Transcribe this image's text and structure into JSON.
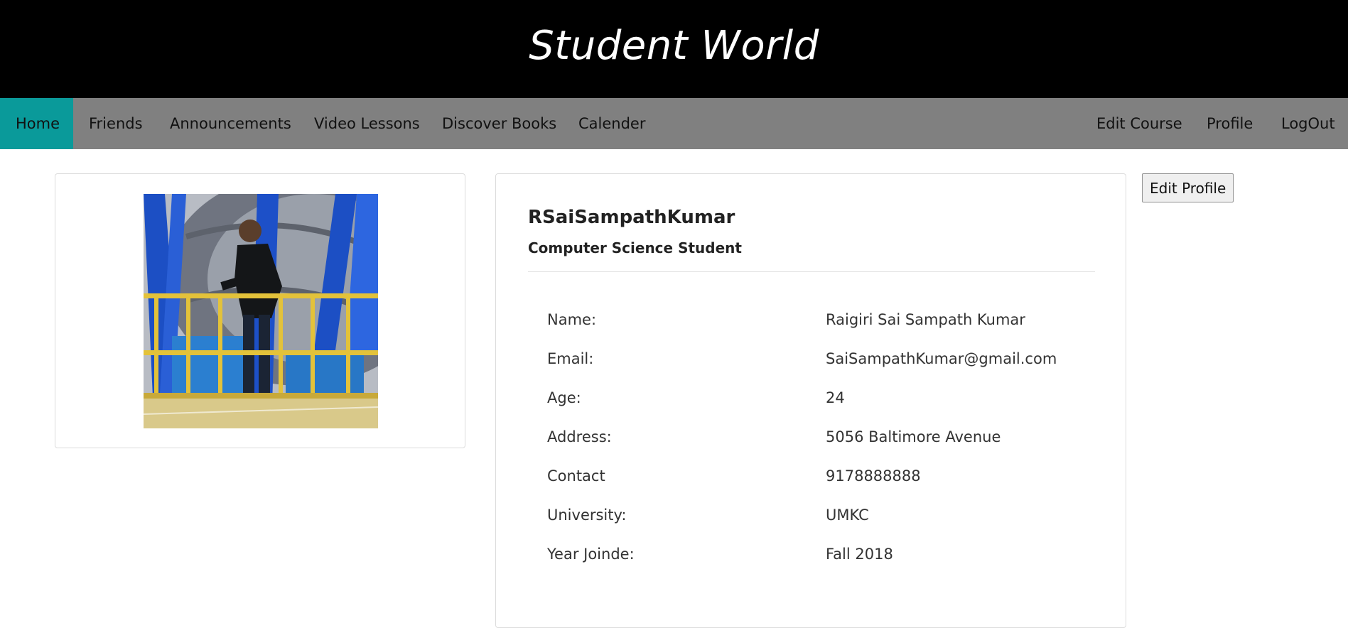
{
  "header": {
    "title": "Student World"
  },
  "nav": {
    "left": [
      {
        "label": "Home",
        "active": true
      },
      {
        "label": "Friends"
      },
      {
        "label": "Announcements"
      },
      {
        "label": "Video Lessons"
      },
      {
        "label": "Discover Books"
      },
      {
        "label": "Calender"
      }
    ],
    "right": [
      {
        "label": "Edit Course"
      },
      {
        "label": "Profile"
      },
      {
        "label": "LogOut"
      }
    ]
  },
  "profile": {
    "username": "RSaiSampathKumar",
    "title": "Computer Science Student",
    "photo_icon": "profile-photo",
    "fields": [
      {
        "label": "Name:",
        "value": "Raigiri Sai Sampath Kumar"
      },
      {
        "label": "Email:",
        "value": "SaiSampathKumar@gmail.com"
      },
      {
        "label": "Age:",
        "value": "24"
      },
      {
        "label": "Address:",
        "value": "5056 Baltimore Avenue"
      },
      {
        "label": "Contact",
        "value": "9178888888"
      },
      {
        "label": "University:",
        "value": "UMKC"
      },
      {
        "label": "Year Joinde:",
        "value": "Fall 2018"
      }
    ],
    "edit_button_label": "Edit Profile"
  },
  "colors": {
    "header_bg": "#000000",
    "nav_bg": "#808080",
    "nav_active": "#0a9a9a"
  }
}
